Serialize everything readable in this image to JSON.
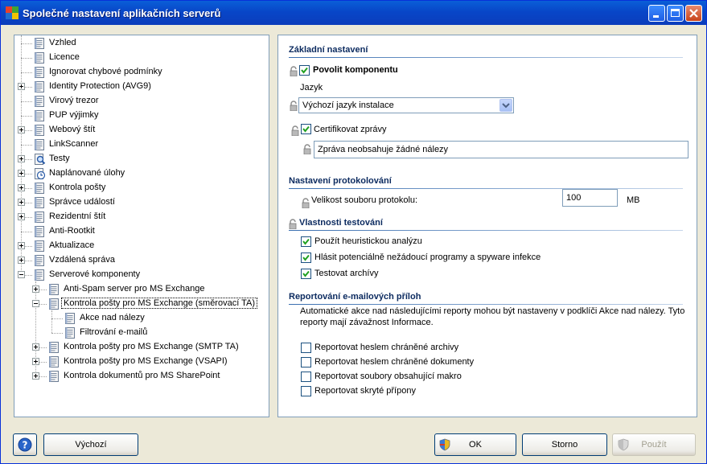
{
  "window": {
    "title": "Společné nastavení aplikačních serverů"
  },
  "tree": {
    "items": [
      {
        "label": "Vzhled",
        "level": 0,
        "expander": false
      },
      {
        "label": "Licence",
        "level": 0,
        "expander": false
      },
      {
        "label": "Ignorovat chybové podmínky",
        "level": 0,
        "expander": false
      },
      {
        "label": "Identity Protection (AVG9)",
        "level": 0,
        "expander": "plus"
      },
      {
        "label": "Virový trezor",
        "level": 0,
        "expander": false
      },
      {
        "label": "PUP výjimky",
        "level": 0,
        "expander": false
      },
      {
        "label": "Webový štít",
        "level": 0,
        "expander": "plus"
      },
      {
        "label": "LinkScanner",
        "level": 0,
        "expander": false
      },
      {
        "label": "Testy",
        "level": 0,
        "expander": "plus"
      },
      {
        "label": "Naplánované úlohy",
        "level": 0,
        "expander": "plus"
      },
      {
        "label": "Kontrola pošty",
        "level": 0,
        "expander": "plus"
      },
      {
        "label": "Správce událostí",
        "level": 0,
        "expander": "plus"
      },
      {
        "label": "Rezidentní štít",
        "level": 0,
        "expander": "plus"
      },
      {
        "label": "Anti-Rootkit",
        "level": 0,
        "expander": false
      },
      {
        "label": "Aktualizace",
        "level": 0,
        "expander": "plus"
      },
      {
        "label": "Vzdálená správa",
        "level": 0,
        "expander": "plus"
      },
      {
        "label": "Serverové komponenty",
        "level": 0,
        "expander": "minus"
      },
      {
        "label": "Anti-Spam server pro MS Exchange",
        "level": 1,
        "expander": "plus"
      },
      {
        "label": "Kontrola pošty pro MS Exchange (směrovací TA)",
        "level": 1,
        "expander": "minus",
        "selected": true
      },
      {
        "label": "Akce nad nálezy",
        "level": 2,
        "expander": false
      },
      {
        "label": "Filtrování e-mailů",
        "level": 2,
        "expander": false
      },
      {
        "label": "Kontrola pošty pro MS Exchange (SMTP TA)",
        "level": 1,
        "expander": "plus"
      },
      {
        "label": "Kontrola pošty pro MS Exchange (VSAPI)",
        "level": 1,
        "expander": "plus"
      },
      {
        "label": "Kontrola dokumentů pro MS SharePoint",
        "level": 1,
        "expander": "plus"
      }
    ]
  },
  "settings": {
    "basic": {
      "title": "Základní nastavení",
      "enable_label": "Povolit komponentu",
      "enable_checked": true,
      "language_label": "Jazyk",
      "language_value": "Výchozí jazyk instalace",
      "certify_label": "Certifikovat zprávy",
      "certify_checked": true,
      "certify_text": "Zpráva neobsahuje žádné nálezy"
    },
    "logging": {
      "title": "Nastavení protokolování",
      "size_label": "Velikost souboru protokolu:",
      "size_value": "100",
      "size_unit": "MB"
    },
    "scan": {
      "title": "Vlastnosti testování",
      "options": [
        {
          "label": "Použít heuristickou analýzu",
          "checked": true
        },
        {
          "label": "Hlásit potenciálně nežádoucí programy a spyware infekce",
          "checked": true
        },
        {
          "label": "Testovat archívy",
          "checked": true
        }
      ]
    },
    "reporting": {
      "title": "Reportování e-mailových příloh",
      "desc_line1": "Automatické akce nad následujícími reporty mohou být nastaveny v podklíči Akce nad nálezy. Tyto",
      "desc_line2": "reporty mají závažnost Informace.",
      "options": [
        {
          "label": "Reportovat heslem chráněné archivy",
          "checked": false
        },
        {
          "label": "Reportovat heslem chráněné dokumenty",
          "checked": false
        },
        {
          "label": "Reportovat soubory obsahující makro",
          "checked": false
        },
        {
          "label": "Reportovat skryté přípony",
          "checked": false
        }
      ]
    }
  },
  "buttons": {
    "default_label": "Výchozí",
    "ok_label": "OK",
    "cancel_label": "Storno",
    "apply_label": "Použít"
  }
}
